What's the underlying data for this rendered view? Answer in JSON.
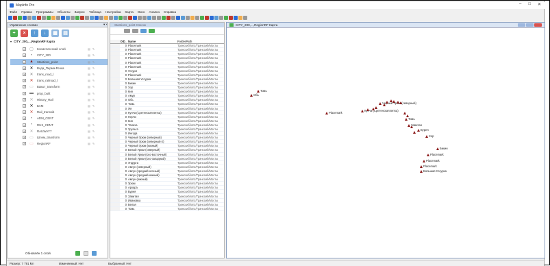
{
  "window": {
    "title": "MapInfo Pro",
    "min": "–",
    "max": "□",
    "close": "✕"
  },
  "menu": [
    "Файл",
    "Правка",
    "Программы",
    "Объекты",
    "Запрос",
    "Таблица",
    "Настройка",
    "Карта",
    "Окно",
    "Анализ",
    "Справка"
  ],
  "layer_panel": {
    "title": "Управление слоями",
    "pin": "▾ ×",
    "map_title": "CITY_200,...,RegionRF Карта",
    "footer": "Обновлён 1 слой",
    "layers": [
      {
        "name": "Косметический слой",
        "sym": "cosmetic-icon",
        "color": "#999999"
      },
      {
        "name": "CITY_200",
        "sym": "point-icon",
        "color": "#999999"
      },
      {
        "name": "Stantions_point",
        "sym": "triangle-icon",
        "color": "#8b1a1a",
        "selected": true
      },
      {
        "name": "Вода_Перма-Речка",
        "sym": "cross-icon",
        "color": "#000000"
      },
      {
        "name": "trans_road_l",
        "sym": "cross-icon",
        "color": "#888888"
      },
      {
        "name": "trans_railroad_l",
        "sym": "cross-red-icon",
        "color": "#c0392b"
      },
      {
        "name": "Бакыт_transform",
        "sym": "rect-icon",
        "color": "#bbbbbb"
      },
      {
        "name": "prop_built",
        "sym": "rect-dark-icon",
        "color": "#777777"
      },
      {
        "name": "History_Rail",
        "sym": "cross-icon",
        "color": "#aaaaaa"
      },
      {
        "name": "БАМ",
        "sym": "cross-icon",
        "color": "#000000"
      },
      {
        "name": "Rail_transsib",
        "sym": "cross-red-icon",
        "color": "#c0392b"
      },
      {
        "name": "ADM_CENT",
        "sym": "point-icon",
        "color": "#999999"
      },
      {
        "name": "RUS_CENT",
        "sym": "point-icon",
        "color": "#999999"
      },
      {
        "name": "RAILWAY7",
        "sym": "cross-icon",
        "color": "#aaaaaa"
      },
      {
        "name": "Шлем_transform",
        "sym": "rect-icon",
        "color": "#bbbbbb"
      },
      {
        "name": "RegionRF",
        "sym": "rect-pink-icon",
        "color": "#f2b8b8"
      }
    ]
  },
  "table": {
    "tab": "Stantions_point Список",
    "columns": [
      "OID_",
      "Name",
      "FolderPath"
    ],
    "rows": [
      [
        "0",
        "Placemark",
        "Транссиб.kmz/Транссиб/Мосты"
      ],
      [
        "0",
        "Placemark",
        "Транссиб.kmz/Транссиб/Мосты"
      ],
      [
        "0",
        "Placemark",
        "Транссиб.kmz/Транссиб/Мосты"
      ],
      [
        "0",
        "Placemark",
        "Транссиб.kmz/Транссиб/Мосты"
      ],
      [
        "0",
        "Placemark",
        "Транссиб.kmz/Транссиб/Мосты"
      ],
      [
        "0",
        "Placemark",
        "Транссиб.kmz/Транссиб/Мосты"
      ],
      [
        "0",
        "Уссури",
        "Транссиб.kmz/Транссиб/Мосты"
      ],
      [
        "0",
        "Placemark",
        "Транссиб.kmz/Транссиб/Мосты"
      ],
      [
        "0",
        "Большая Уссурка",
        "Транссиб.kmz/Транссиб/Мосты"
      ],
      [
        "0",
        "Бикин",
        "Транссиб.kmz/Транссиб/Мосты"
      ],
      [
        "0",
        "Хор",
        "Транссиб.kmz/Транссиб/Мосты"
      ],
      [
        "0",
        "Кия",
        "Транссиб.kmz/Транссиб/Мосты"
      ],
      [
        "0",
        "Амур",
        "Транссиб.kmz/Транссиб/Мосты"
      ],
      [
        "0",
        "Обь",
        "Транссиб.kmz/Транссиб/Мосты"
      ],
      [
        "0",
        "Томь",
        "Транссиб.kmz/Транссиб/Мосты"
      ],
      [
        "0",
        "Яя",
        "Транссиб.kmz/Транссиб/Мосты"
      ],
      [
        "0",
        "Кунча (Сретенская ветка)",
        "Транссиб.kmz/Транссиб/Мосты"
      ],
      [
        "0",
        "Нерчи",
        "Транссиб.kmz/Транссиб/Мосты"
      ],
      [
        "0",
        "Кия",
        "Транссиб.kmz/Транссиб/Мосты"
      ],
      [
        "0",
        "Талача",
        "Транссиб.kmz/Транссиб/Мосты"
      ],
      [
        "0",
        "Урульга",
        "Транссиб.kmz/Транссиб/Мосты"
      ],
      [
        "0",
        "Ингода",
        "Транссиб.kmz/Транссиб/Мосты"
      ],
      [
        "0",
        "Черный Урюм (северный)",
        "Транссиб.kmz/Транссиб/Мосты"
      ],
      [
        "0",
        "Черный Урюм (северный-2)",
        "Транссиб.kmz/Транссиб/Мосты"
      ],
      [
        "0",
        "Черный Урюм (южный)",
        "Транссиб.kmz/Транссиб/Мосты"
      ],
      [
        "0",
        "Белый Урюм (северный)",
        "Транссиб.kmz/Транссиб/Мосты"
      ],
      [
        "0",
        "Белый Урюм (юго-восточный)",
        "Транссиб.kmz/Транссиб/Мосты"
      ],
      [
        "0",
        "Белый Урюм (юго-западный)",
        "Транссиб.kmz/Транссиб/Мосты"
      ],
      [
        "0",
        "Ундурга",
        "Транссиб.kmz/Транссиб/Мосты"
      ],
      [
        "0",
        "Амгун (северный)",
        "Транссиб.kmz/Транссиб/Мосты"
      ],
      [
        "0",
        "Амгун (средний-ночный)",
        "Транссиб.kmz/Транссиб/Мосты"
      ],
      [
        "0",
        "Амгун (средний-южный)",
        "Транссиб.kmz/Транссиб/Мосты"
      ],
      [
        "0",
        "Амгун (южный)",
        "Транссиб.kmz/Транссиб/Мосты"
      ],
      [
        "0",
        "Урюм",
        "Транссиб.kmz/Транссиб/Мосты"
      ],
      [
        "0",
        "Архара",
        "Транссиб.kmz/Транссиб/Мосты"
      ],
      [
        "0",
        "Бурея",
        "Транссиб.kmz/Транссиб/Мосты"
      ],
      [
        "0",
        "Завитая",
        "Транссиб.kmz/Транссиб/Мосты"
      ],
      [
        "0",
        "Ивановка",
        "Транссиб.kmz/Транссиб/Мосты"
      ],
      [
        "0",
        "Белая",
        "Транссиб.kmz/Транссиб/Мосты"
      ],
      [
        "0",
        "Томь",
        "Транссиб.kmz/Транссиб/Мосты"
      ]
    ]
  },
  "map": {
    "title": "CITY_200,...,RegionRF Карта",
    "points": [
      {
        "label": "Томь"
      },
      {
        "label": "Обь"
      },
      {
        "label": "Placemark"
      },
      {
        "label": "Черный Урюм (северный)"
      },
      {
        "label": "Кунча (Сретенская ветка)"
      },
      {
        "label": "Томь"
      },
      {
        "label": "Завитая"
      },
      {
        "label": "Бурея"
      },
      {
        "label": "Хор"
      },
      {
        "label": "Бикин"
      },
      {
        "label": "Placemark"
      },
      {
        "label": "Placemark"
      },
      {
        "label": "Placemark"
      },
      {
        "label": "Большая Уссурка"
      }
    ]
  },
  "status": {
    "zoom": "Размер: 7 791 km",
    "editable": "Изменяемый: Нет",
    "selectable": "Выбранный: Нет"
  }
}
